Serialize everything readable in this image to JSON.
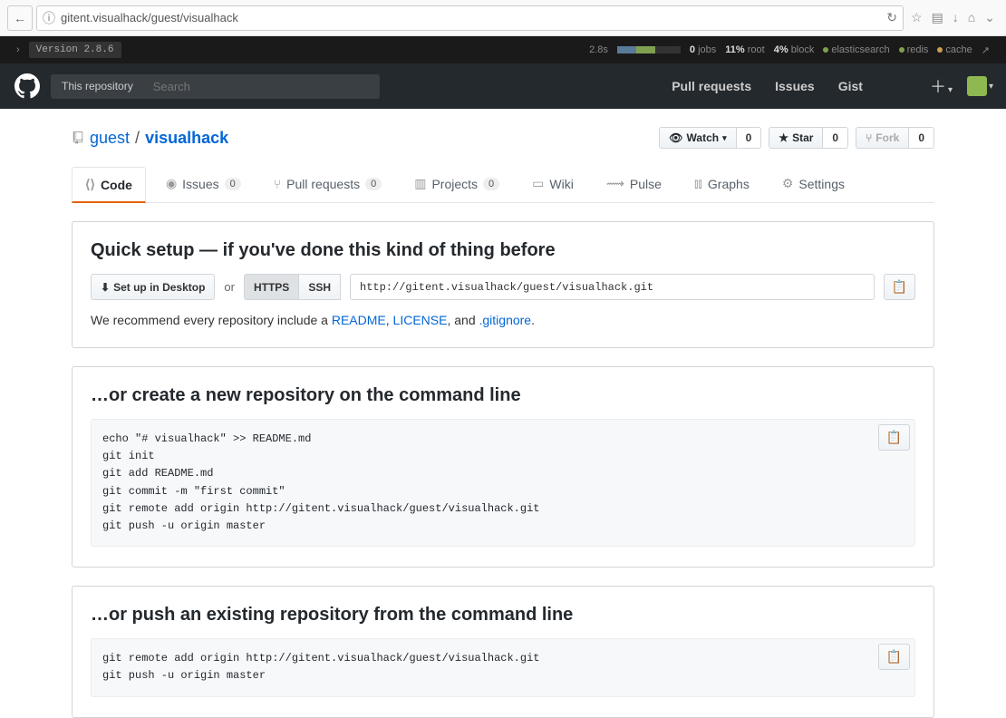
{
  "browser": {
    "url": "gitent.visualhack/guest/visualhack",
    "info_glyph": "ⓘ"
  },
  "debug": {
    "chevron": "›",
    "version": "Version 2.8.6",
    "time": "2.8s",
    "jobs_n": "0",
    "jobs_l": "jobs",
    "root_n": "11%",
    "root_l": "root",
    "block_n": "4%",
    "block_l": "block",
    "es": "elasticsearch",
    "redis": "redis",
    "cache": "cache"
  },
  "nav": {
    "scope": "This repository",
    "search_ph": "Search",
    "pulls": "Pull requests",
    "issues": "Issues",
    "gist": "Gist"
  },
  "repo": {
    "owner": "guest",
    "sep": "/",
    "name": "visualhack",
    "watch": "Watch",
    "watch_c": "0",
    "star": "Star",
    "star_c": "0",
    "fork": "Fork",
    "fork_c": "0"
  },
  "tabs": {
    "code": "Code",
    "issues": "Issues",
    "issues_c": "0",
    "pulls": "Pull requests",
    "pulls_c": "0",
    "projects": "Projects",
    "projects_c": "0",
    "wiki": "Wiki",
    "pulse": "Pulse",
    "graphs": "Graphs",
    "settings": "Settings"
  },
  "setup": {
    "heading": "Quick setup — if you've done this kind of thing before",
    "desktop": "Set up in Desktop",
    "or": "or",
    "https": "HTTPS",
    "ssh": "SSH",
    "clone_url": "http://gitent.visualhack/guest/visualhack.git",
    "rec_pre": "We recommend every repository include a ",
    "readme": "README",
    "c1": ", ",
    "license": "LICENSE",
    "c2": ", and ",
    "gitignore": ".gitignore",
    "c3": "."
  },
  "create": {
    "heading": "…or create a new repository on the command line",
    "cmd": "echo \"# visualhack\" >> README.md\ngit init\ngit add README.md\ngit commit -m \"first commit\"\ngit remote add origin http://gitent.visualhack/guest/visualhack.git\ngit push -u origin master"
  },
  "push": {
    "heading": "…or push an existing repository from the command line",
    "cmd": "git remote add origin http://gitent.visualhack/guest/visualhack.git\ngit push -u origin master"
  }
}
